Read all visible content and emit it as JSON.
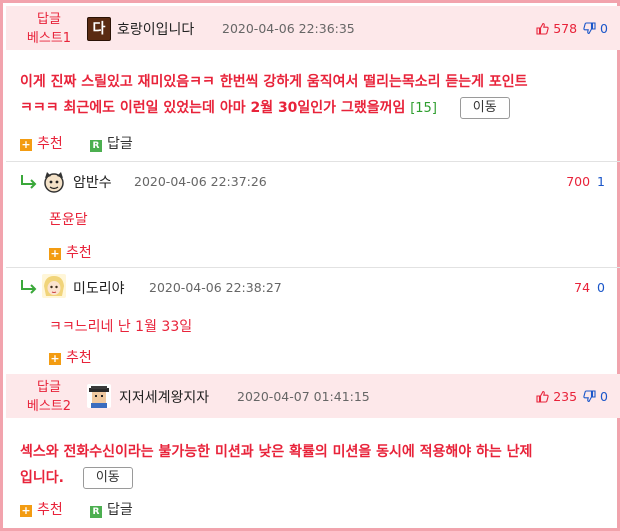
{
  "comments": [
    {
      "badge_line1": "답글",
      "badge_line2": "베스트1",
      "nick": "호랑이입니다",
      "avatar_letter": "다",
      "date": "2020-04-06 22:36:35",
      "up": "578",
      "down": "0",
      "text_line1": "이게 진짜 스릴있고 재미있음ㅋㅋ 한번씩 강하게 움직여서 떨리는목소리 듣는게 포인트",
      "text_line2": "ㅋㅋㅋ 최근에도 이런일 있었는데 아마 2월 30일인가 그랬을꺼임",
      "reply_count": "[15]",
      "move_label": "이동",
      "recommend_label": "추천",
      "reply_label": "답글"
    },
    {
      "badge_line1": "답글",
      "badge_line2": "베스트2",
      "nick": "지저세계왕지자",
      "date": "2020-04-07 01:41:15",
      "up": "235",
      "down": "0",
      "text_line1": "섹스와 전화수신이라는 불가능한 미션과 낮은 확률의 미션을 동시에 적용해야 하는 난제",
      "text_line2": "입니다.",
      "move_label": "이동",
      "recommend_label": "추천",
      "reply_label": "답글"
    }
  ],
  "replies": [
    {
      "nick": "암반수",
      "date": "2020-04-06 22:37:26",
      "up": "700",
      "down": "1",
      "text": "폰윤달",
      "recommend_label": "추천"
    },
    {
      "nick": "미도리야",
      "date": "2020-04-06 22:38:27",
      "up": "74",
      "down": "0",
      "text": "ㅋㅋ느리네 난 1월 33일",
      "recommend_label": "추천"
    }
  ],
  "colors": {
    "accent_red": "#e8233a",
    "down_blue": "#1a56c9",
    "best_bg": "#fde8ea",
    "border_pink": "#f2a3ad",
    "count_green": "#2e9e2e"
  },
  "icons": [
    "thumb-up-icon",
    "thumb-down-icon",
    "plus-icon",
    "reply-r-icon",
    "reply-arrow-icon"
  ]
}
